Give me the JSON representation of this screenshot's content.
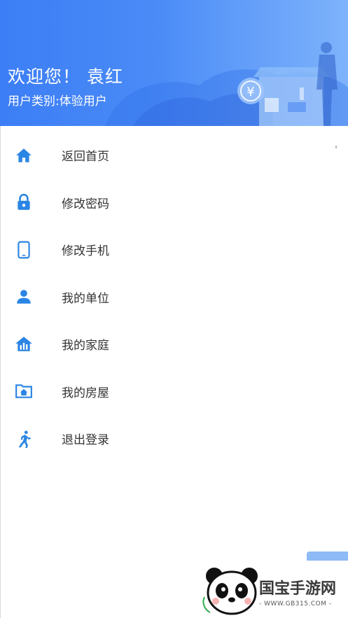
{
  "header": {
    "welcome_text": "欢迎您！ 袁红",
    "user_type_text": "用户类别:体验用户",
    "coin_symbol": "¥",
    "gradient_colors": [
      "#3c7ef5",
      "#7eb3fb"
    ]
  },
  "menu": {
    "items": [
      {
        "label": "返回首页",
        "icon": "home-icon"
      },
      {
        "label": "修改密码",
        "icon": "lock-icon"
      },
      {
        "label": "修改手机",
        "icon": "phone-icon"
      },
      {
        "label": "我的单位",
        "icon": "person-icon"
      },
      {
        "label": "我的家庭",
        "icon": "family-house-icon"
      },
      {
        "label": "我的房屋",
        "icon": "folder-house-icon"
      },
      {
        "label": "退出登录",
        "icon": "runner-icon"
      }
    ],
    "icon_color": "#2b85e4",
    "label_color": "#333333"
  },
  "watermark": {
    "brand_text": "国宝手游网",
    "url_text": "- WWW.GB315.COM -"
  }
}
